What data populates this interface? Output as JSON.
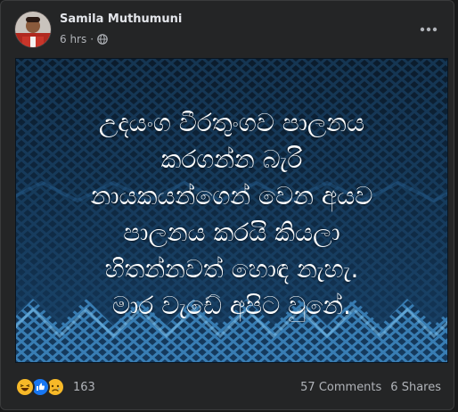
{
  "post": {
    "author": "Samila Muthumuni",
    "time": "6 hrs",
    "separator": "·",
    "privacy_icon": "globe-icon",
    "text_lines": [
      "උදයංග වීරතුංගව පාලනය",
      "කරගන්න බැරි",
      "නායකයන්ගෙන් වෙන අයව",
      "පාලනය කරයි කියලා",
      "හිතන්නවත් හොඳ නැහැ.",
      "මාර වැඩේ අපිට වුනේ."
    ],
    "reactions": {
      "icons": [
        "haha-icon",
        "like-icon",
        "sad-icon"
      ],
      "count": "163"
    },
    "comments": "57 Comments",
    "shares": "6 Shares"
  },
  "colors": {
    "card_bg": "#242526",
    "page_bg": "#18191a",
    "text_primary": "#e4e6eb",
    "text_secondary": "#b0b3b8",
    "image_bg": "#0e2336"
  }
}
